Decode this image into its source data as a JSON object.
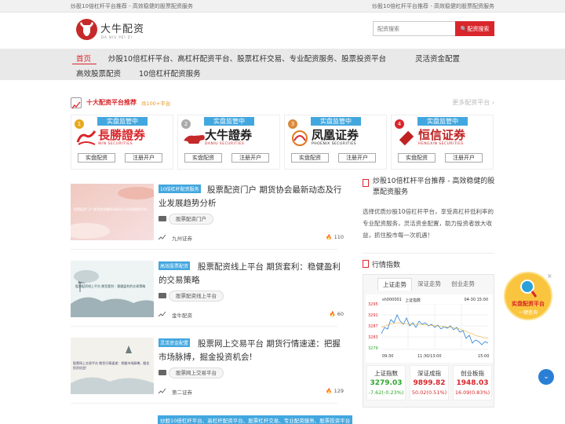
{
  "topbar": {
    "left": "炒股10倍杠杆平台推荐 - 高效稳健的股票配资服务",
    "right": "炒股10倍杠杆平台推荐 - 高效稳健的股票配资服务"
  },
  "logo": {
    "name": "大牛配资",
    "sub": "DA NIU PEI ZI"
  },
  "search": {
    "placeholder": "配资搜索",
    "button": "🔍配资搜索"
  },
  "nav": {
    "items": [
      "首页",
      "炒股10倍杠杆平台、高杠杆配资平台、股票杠杆交易、专业配资服务、股票投资平台",
      "灵活资金配置",
      "高效股票配资",
      "10倍杠杆配资服务"
    ]
  },
  "section": {
    "title": "十大配资平台推荐",
    "count": "共100+平台",
    "more": "更多配资平台 ›"
  },
  "brokers": [
    {
      "rank": "1",
      "banner": "实盘监管中",
      "name": "長勝證券",
      "sub": "WIN SECURITIES",
      "color": "#d9262b",
      "btn1": "实盘配资",
      "btn2": "注册开户"
    },
    {
      "rank": "2",
      "banner": "实盘监管中",
      "name": "大牛證券",
      "sub": "DANIU SECURITIES",
      "color": "#222222",
      "btn1": "实盘配资",
      "btn2": "注册开户"
    },
    {
      "rank": "3",
      "banner": "实盘监管中",
      "name": "凤凰证券",
      "sub": "PHOENIX SECURITIES",
      "color": "#222222",
      "btn1": "实盘配资",
      "btn2": "注册开户"
    },
    {
      "rank": "4",
      "banner": "实盘监管中",
      "name": "恒信证券",
      "sub": "HENGXIN SECURITIES",
      "color": "#c02222",
      "btn1": "实盘配资",
      "btn2": "注册开户"
    }
  ],
  "articles": [
    {
      "category": "10倍杠杆配资服务",
      "title": "股票配资门户 期货协会最新动态及行业发展趋势分析",
      "thumb_text": "股票配资门户 期货协会最新动态及行业发展趋势分析",
      "tag": "股票配资门户",
      "author": "九州证券",
      "views": "110"
    },
    {
      "category": "高效股票配资",
      "title": "股票配资线上平台 期货套利：稳健盈利的交易策略",
      "thumb_text": "股票配资线上平台 期货套利：稳健盈利的交易策略",
      "tag": "股票配资线上平台",
      "author": "金牛配资",
      "views": "60"
    },
    {
      "category": "灵活资金配置",
      "title": "股票网上交易平台 期货行情速递：把握市场脉搏，掘金投资机会!",
      "thumb_text": "股票网上交易平台 期货行情速递：把握市场脉搏，掘金投资机会!",
      "tag": "股票网上交易平台",
      "author": "第二证券",
      "views": "129"
    }
  ],
  "bottom_category": "炒股10倍杠杆平台、高杠杆配资平台、股票杠杆交易、专业配资服务、股票投资平台",
  "sidebar": {
    "title": "炒股10倍杠杆平台推荐 - 高效稳健的股票配资服务",
    "desc": "选择优质炒股10倍杠杆平台，享受高杠杆低利率的专业配资服务，灵活资金配置，助力投资者放大收益，抓住股市每一次机遇！",
    "market_title": "行情指数",
    "tabs": [
      "上证走势",
      "深证走势",
      "创业走势"
    ],
    "chart": {
      "code": "sh000001",
      "name": "上证指数",
      "time_range": "04-30 15:00",
      "y_ticks": [
        "3295",
        "3291",
        "3287",
        "3283",
        "3279"
      ],
      "x_ticks": [
        "09:30",
        "11:30/13:00",
        "15:00"
      ]
    },
    "indices": [
      {
        "name": "上证指数",
        "value": "3279.03",
        "change": "-7.62(-0.23%)",
        "color": "green"
      },
      {
        "name": "深证成指",
        "value": "9899.82",
        "change": "50.02(0.51%)",
        "color": "red"
      },
      {
        "name": "创业板指",
        "value": "1948.03",
        "change": "16.09(0.83%)",
        "color": "red"
      }
    ]
  },
  "float_badge": {
    "label": "实盘配资平台",
    "sub": "一键查询",
    "close": "×"
  },
  "scroll_top": "⌄"
}
